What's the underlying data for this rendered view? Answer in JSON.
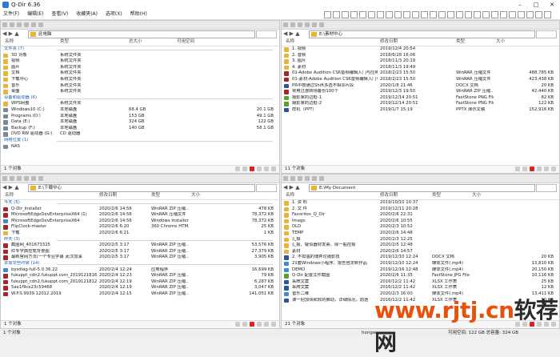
{
  "app": {
    "title": "Q-Dir 6.36"
  },
  "menu": [
    "文件(F)",
    "编辑(E)",
    "查看(V)",
    "收藏夹(A)",
    "选项(X)",
    "帮助(H)"
  ],
  "colors": {
    "folder": "#e8b53a",
    "drive": "#7a8899",
    "zip": "#a8232a",
    "group": "#1b5fb3",
    "doc": "#2b579a",
    "img": "#5aa02c",
    "exe": "#3b8ed6"
  },
  "panes": [
    {
      "address": "此电脑",
      "headers": [
        "名称",
        "类型",
        "总大小",
        "可用空间"
      ],
      "rows": [
        {
          "kind": "group",
          "name": "文件夹 (7)"
        },
        {
          "icon": "folder",
          "cells": [
            "3D 对象",
            "系统文件夹",
            "",
            ""
          ]
        },
        {
          "icon": "folder",
          "cells": [
            "视频",
            "系统文件夹",
            "",
            ""
          ]
        },
        {
          "icon": "folder",
          "cells": [
            "图片",
            "系统文件夹",
            "",
            ""
          ]
        },
        {
          "icon": "folder",
          "cells": [
            "文档",
            "系统文件夹",
            "",
            ""
          ]
        },
        {
          "icon": "folder",
          "cells": [
            "下载中心",
            "系统文件夹",
            "",
            ""
          ]
        },
        {
          "icon": "folder",
          "cells": [
            "音乐",
            "系统文件夹",
            "",
            ""
          ]
        },
        {
          "icon": "folder",
          "cells": [
            "桌面",
            "系统文件夹",
            "",
            ""
          ]
        },
        {
          "kind": "group",
          "name": "设备和驱动器 (6)"
        },
        {
          "icon": "folder",
          "cells": [
            "WPS网盘",
            "系统文件夹",
            "",
            ""
          ]
        },
        {
          "icon": "drive",
          "cells": [
            "Windows10 (C:)",
            "本地磁盘",
            "68.4 GB",
            "20.1 GB"
          ]
        },
        {
          "icon": "drive",
          "cells": [
            "Programs (D:)",
            "本地磁盘",
            "153 GB",
            "49.1 GB"
          ]
        },
        {
          "icon": "drive",
          "cells": [
            "Data (E:)",
            "本地磁盘",
            "324 GB",
            "122 GB"
          ]
        },
        {
          "icon": "drive",
          "cells": [
            "Backup (F:)",
            "本地磁盘",
            "140 GB",
            "58.1 GB"
          ]
        },
        {
          "icon": "drive",
          "cells": [
            "DVD RW 驱动器 (G:)",
            "CD 驱动器",
            "",
            ""
          ]
        },
        {
          "kind": "group",
          "name": "网络位置 (1)"
        },
        {
          "icon": "drive",
          "cells": [
            "NAS",
            "",
            "",
            ""
          ]
        }
      ],
      "status": "1 个对象"
    },
    {
      "address": "E:\\素材中心",
      "headers": [
        "名称",
        "修改日期",
        "类型",
        "大小"
      ],
      "rows": [
        {
          "icon": "folder",
          "cells": [
            "1. 视频",
            "2019/12/4 20:54",
            "",
            ""
          ]
        },
        {
          "icon": "folder",
          "cells": [
            "2. 音频",
            "2018/6/28 16:06",
            "",
            ""
          ]
        },
        {
          "icon": "folder",
          "cells": [
            "3. 图片",
            "2018/11/3 20:19",
            "",
            ""
          ]
        },
        {
          "icon": "folder",
          "cells": [
            "4. 素材",
            "2018/11/3 19:49",
            "",
            ""
          ]
        },
        {
          "icon": "zip",
          "cells": [
            "01-Adobe Audition CS6音频编辑入门与应用",
            "2018/2/23 15:50",
            "WinRAR 压缩文件",
            "488,785 KB"
          ]
        },
        {
          "icon": "zip",
          "cells": [
            "01-素材-Adobe Audition CS6音频编辑入门与应用",
            "2018/2/23 15:50",
            "WinRAR 压缩文件",
            "423,438 KB"
          ]
        },
        {
          "icon": "doc",
          "cells": [
            "PR中按通过Shift多选不相邻片段",
            "2020/1/8 21:46",
            "DOCX 文档",
            "20 KB"
          ]
        },
        {
          "icon": "zip",
          "cells": [
            "常用过渡转场备份100个",
            "2019/12/3 19:50",
            "WinRAR ZIP 压缩...",
            "42,440 KB"
          ]
        },
        {
          "icon": "img",
          "cells": [
            "摄影家的边框-1",
            "2019/12/14 20:51",
            "FastStone PNG File",
            "82 KB"
          ]
        },
        {
          "icon": "img",
          "cells": [
            "摄影家的边框-2",
            "2019/12/14 20:51",
            "FastStone PNG File",
            "122 KB"
          ]
        },
        {
          "icon": "doc",
          "cells": [
            "样机（PPT）",
            "2019/1/7 15:19",
            "PPTX 演示文稿",
            "152,916 KB"
          ]
        }
      ],
      "status": "11 个对象"
    },
    {
      "address": "E:\\下载中心",
      "headers": [
        "名称",
        "修改日期",
        "类型",
        "大小"
      ],
      "rows": [
        {
          "kind": "group",
          "name": "今天 (5)"
        },
        {
          "icon": "zip",
          "cells": [
            "Q-Dir_Installer",
            "2020/2/6 14:56",
            "WinRAR ZIP 压缩...",
            "478 KB"
          ]
        },
        {
          "icon": "zip",
          "cells": [
            "MicrosoftEdgeDevEnterpriseX64 (1)",
            "2020/2/6 14:56",
            "WinRAR 压缩文件",
            "78,372 KB"
          ]
        },
        {
          "icon": "exe",
          "cells": [
            "MicrosoftEdgeDevEnterpriseX64",
            "2020/2/6 14:56",
            "Windows Installer ...",
            "78,372 KB"
          ]
        },
        {
          "icon": "zip",
          "cells": [
            "FlipClock-master",
            "2020/2/6 6:20",
            "360 Chrome HTM...",
            "25 KB"
          ]
        },
        {
          "icon": "folder",
          "cells": [
            "下载",
            "2020/2/6 6:21",
            "",
            "1 KB"
          ]
        },
        {
          "kind": "group",
          "name": "昨天 (3)"
        },
        {
          "icon": "zip",
          "cells": [
            "截图网_401673325",
            "2020/2/5 3:17",
            "WinRAR ZIP 压缩...",
            "53,576 KB"
          ]
        },
        {
          "icon": "zip",
          "cells": [
            "红专字典控笔背景图",
            "2020/2/5 3:17",
            "WinRAR ZIP 压缩...",
            "27,379 KB"
          ]
        },
        {
          "icon": "zip",
          "cells": [
            "最新官网方法(一个专业字幕 武汉加油",
            "2020/2/5 3:17",
            "WinRAR ZIP 压缩...",
            "3,905 KB"
          ]
        },
        {
          "kind": "group",
          "name": "本周早些时候 (14)"
        },
        {
          "icon": "exe",
          "cells": [
            "bysdiag-full-5.0.36.22",
            "2020/2/4 12:24",
            "应用程序",
            "16,699 KB"
          ]
        },
        {
          "icon": "zip",
          "cells": [
            "fukuppt_cdn2.fukuppt.com_20191218164...",
            "2020/2/4 12:23",
            "WinRAR ZIP 压缩...",
            "79 KB"
          ]
        },
        {
          "icon": "zip",
          "cells": [
            "fukuppt_cdn2.fukuppt.com_20191218127...",
            "2020/2/4 12:19",
            "WinRAR ZIP 压缩...",
            "6,287 KB"
          ]
        },
        {
          "icon": "zip",
          "cells": [
            "5ae1f9ce23c59468",
            "2020/2/4 12:19",
            "WinRAR ZIP 压缩...",
            "3,047 KB"
          ]
        },
        {
          "icon": "zip",
          "cells": [
            "W.P.S.9939.12012.2019",
            "2020/2/4 12:15",
            "WinRAR ZIP 压缩...",
            "141,051 KB"
          ]
        }
      ],
      "status": "1 个对象"
    },
    {
      "address": "E:\\My Document",
      "headers": [
        "名称",
        "修改日期",
        "类型",
        "大小"
      ],
      "rows": [
        {
          "icon": "folder",
          "cells": [
            "1. 资    料",
            "2019/10/10 10:37",
            "",
            ""
          ]
        },
        {
          "icon": "folder",
          "cells": [
            "2. 文    件",
            "2019/12/11 20:28",
            "",
            ""
          ]
        },
        {
          "icon": "folder",
          "cells": [
            "Favorites_Q_Dir",
            "2020/2/6 22:31",
            "",
            ""
          ]
        },
        {
          "icon": "folder",
          "cells": [
            "Image",
            "2020/2/6 10:55",
            "",
            ""
          ]
        },
        {
          "icon": "folder",
          "cells": [
            "OLD",
            "2020/2/3 10:52",
            "",
            ""
          ]
        },
        {
          "icon": "folder",
          "cells": [
            "TEMP",
            "2020/2/6 14:48",
            "",
            ""
          ]
        },
        {
          "icon": "folder",
          "cells": [
            "汇报",
            "2020/2/3 12:25",
            "",
            ""
          ]
        },
        {
          "icon": "folder",
          "cells": [
            "汇报、疑似器材发票、除一般控报",
            "2020/2/5 12:48",
            "",
            ""
          ]
        },
        {
          "icon": "folder",
          "cells": [
            "素材",
            "2020/2/6 14:57",
            "",
            ""
          ]
        },
        {
          "icon": "doc",
          "cells": [
            "2. 不如遇的博弈论摄影技",
            "2019/12/10 12:24",
            "DOCX 文档",
            "20 KB"
          ]
        },
        {
          "icon": "exe",
          "cells": [
            "21套Windows小程序、报告自定制作品",
            "2019/12/10 12:24",
            "媒体文件(.mp4)",
            "13,810 KB"
          ]
        },
        {
          "icon": "exe",
          "cells": [
            "DEMO",
            "2019/12/16 12:48",
            "媒体文件(.mp4)",
            "20,150 KB"
          ]
        },
        {
          "icon": "img",
          "cells": [
            "Q-Dir 配置文件截图",
            "2020/2/6 11:35",
            "FastStone JPG File",
            "10,116 KB"
          ]
        },
        {
          "icon": "doc",
          "cells": [
            "采牌文案",
            "2016/12/2 11:42",
            "XLSX 工作表",
            "25 KB"
          ]
        },
        {
          "icon": "doc",
          "cells": [
            "采牌文案",
            "2016/12/2 11:42",
            "XLSX 工作表",
            "12 KB"
          ]
        },
        {
          "icon": "exe",
          "cells": [
            "音乐二维",
            "2020/2/3 16:00",
            "媒体文件(.mp4)",
            "13,411 KB"
          ]
        },
        {
          "icon": "doc",
          "cells": [
            "课一把加快和效的推动，详细情况，前途",
            "2016/12/2 11:42",
            "XLSX 工作表",
            "10 KB"
          ]
        }
      ],
      "status": "21 个对象"
    }
  ],
  "bottom": {
    "left": "1 个对象",
    "user": "hongw",
    "right": "可用空间: 122 GB 总容量: 324 GB"
  },
  "watermark": {
    "main": "www.rjtj.cn",
    "suffix": "软荐网"
  }
}
